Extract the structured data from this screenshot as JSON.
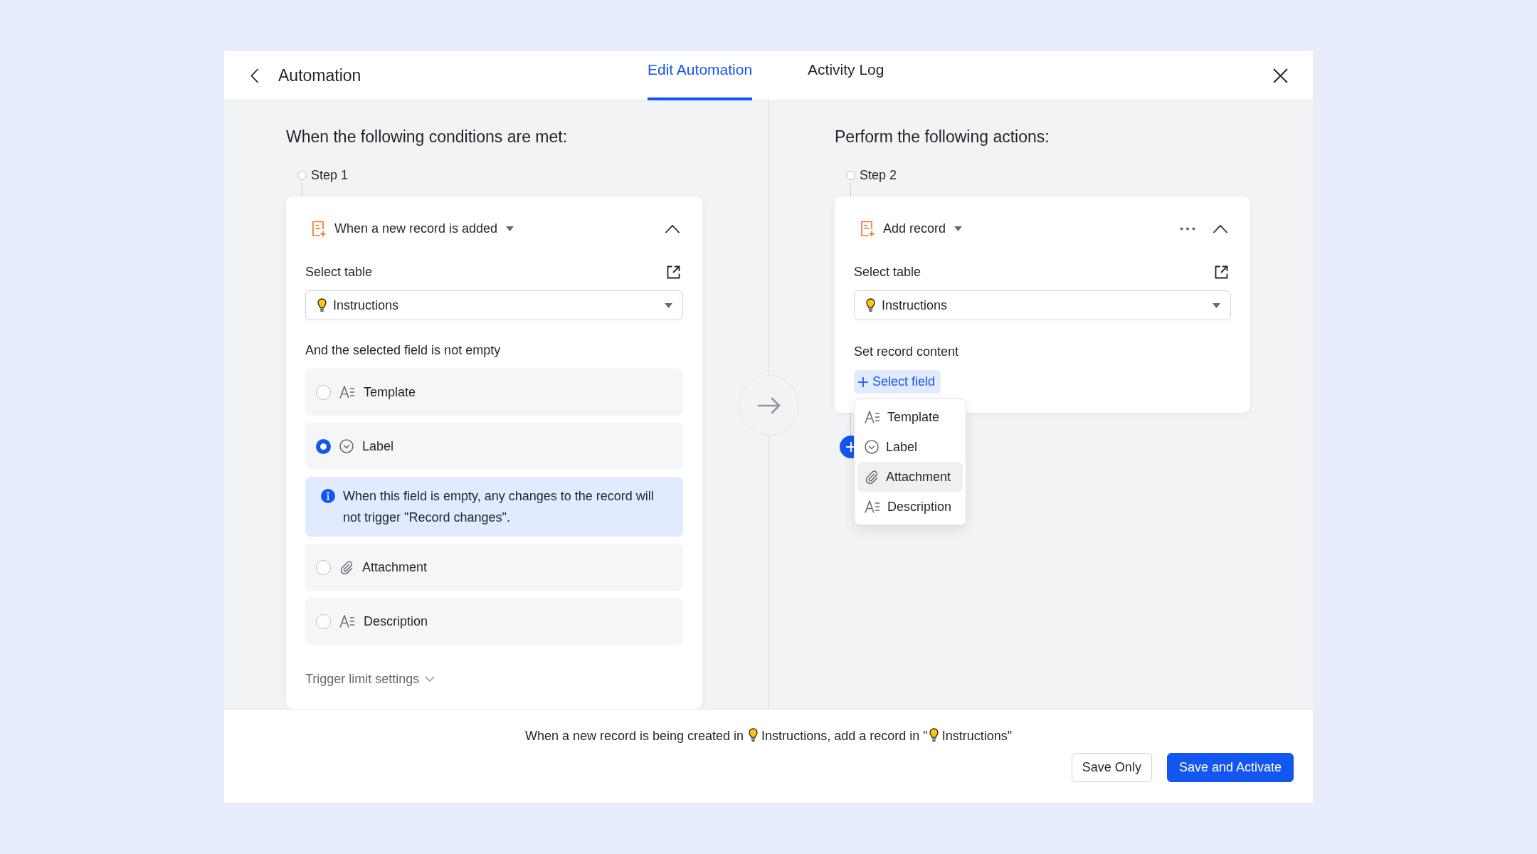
{
  "window": {
    "title": "Automation"
  },
  "tabs": [
    {
      "label": "Edit Automation",
      "selected": true
    },
    {
      "label": "Activity Log",
      "selected": false
    }
  ],
  "conditions": {
    "heading": "When the following conditions are met:",
    "step": "Step 1",
    "trigger": "When a new record is added",
    "table_label": "Select table",
    "table": "Instructions",
    "prompt": "And the selected field is not empty",
    "fields": [
      {
        "kind": "text",
        "name": "Template",
        "selected": false
      },
      {
        "kind": "option",
        "name": "Label",
        "selected": true,
        "note": "When this field is empty, any changes to the record will not trigger \"Record changes\"."
      },
      {
        "kind": "attachment",
        "name": "Attachment",
        "selected": false
      },
      {
        "kind": "text",
        "name": "Description",
        "selected": false
      }
    ],
    "limit_settings": "Trigger limit settings"
  },
  "actions": {
    "heading": "Perform the following actions:",
    "step": "Step 2",
    "action": "Add record",
    "table_label": "Select table",
    "table": "Instructions",
    "content_label": "Set record content",
    "add_field": "Select field",
    "field_menu": [
      {
        "kind": "text",
        "name": "Template",
        "selected": false
      },
      {
        "kind": "option",
        "name": "Label",
        "selected": false
      },
      {
        "kind": "attachment",
        "name": "Attachment",
        "selected": true
      },
      {
        "kind": "text",
        "name": "Description",
        "selected": false
      }
    ]
  },
  "summary": [
    {
      "kind": "text",
      "text": "When a new record is being created in "
    },
    {
      "kind": "table",
      "text": "Instructions"
    },
    {
      "kind": "text",
      "text": ", add a record in \""
    },
    {
      "kind": "table",
      "text": "Instructions"
    },
    {
      "kind": "text",
      "text": "\""
    }
  ],
  "buttons": [
    {
      "label": "Save Only",
      "kind": "secondary"
    },
    {
      "label": "Save and Activate",
      "kind": "primary"
    }
  ]
}
